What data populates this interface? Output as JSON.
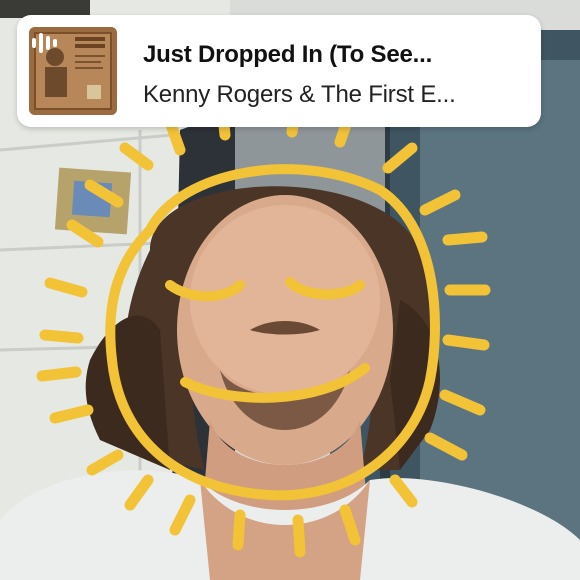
{
  "music_sticker": {
    "title": "Just Dropped In (To See...",
    "artist": "Kenny Rogers & The First E..."
  },
  "colors": {
    "doodle_yellow": "#f2c237",
    "sticker_bg": "#ffffff",
    "album_brown": "#9a6b3e"
  },
  "icons": {
    "playing": "audio-waveform-icon"
  }
}
